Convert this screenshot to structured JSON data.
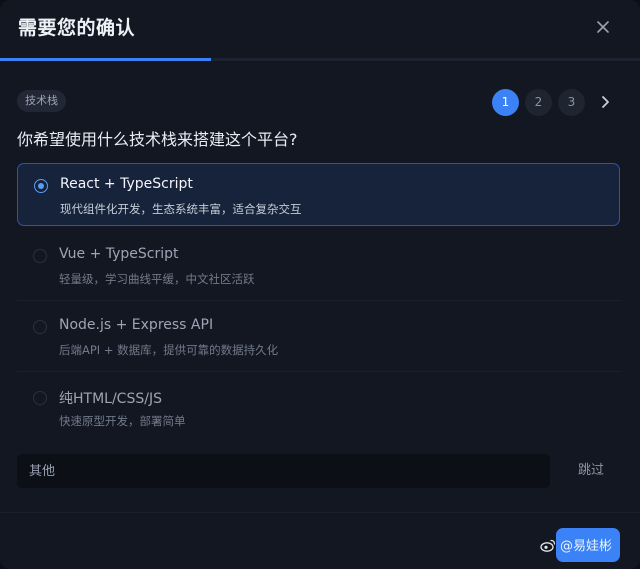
{
  "dialog": {
    "title": "需要您的确认",
    "progress": 0.33
  },
  "question": {
    "tag": "技术栈",
    "text": "你希望使用什么技术栈来搭建这个平台?",
    "steps": [
      "1",
      "2",
      "3"
    ],
    "active_step": 1
  },
  "options": [
    {
      "title": "React + TypeScript",
      "desc": "现代组件化开发，生态系统丰富，适合复杂交互",
      "selected": true
    },
    {
      "title": "Vue + TypeScript",
      "desc": "轻量级，学习曲线平缓，中文社区活跃",
      "selected": false
    },
    {
      "title": "Node.js + Express API",
      "desc": "后端API + 数据库，提供可靠的数据持久化",
      "selected": false
    },
    {
      "title": "纯HTML/CSS/JS",
      "desc": "快速原型开发，部署简单",
      "selected": false
    }
  ],
  "other": {
    "placeholder": "其他",
    "skip_label": "跳过"
  },
  "watermark": {
    "text": "@易娃彬"
  },
  "colors": {
    "accent": "#3b82f6",
    "background": "#131722"
  },
  "icons": {
    "close": "close-icon",
    "next": "chevron-right-icon"
  }
}
